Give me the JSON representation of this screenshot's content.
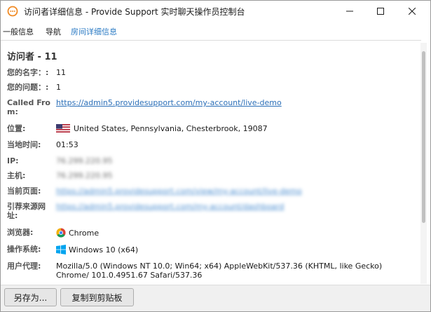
{
  "window": {
    "title": "访问者详细信息 - Provide Support 实时聊天操作员控制台"
  },
  "tabs": [
    {
      "label": "一般信息"
    },
    {
      "label": "导航"
    },
    {
      "label": "房间详细信息"
    }
  ],
  "visitor": {
    "heading": "访问者 - 11",
    "fields": {
      "name": {
        "label": "您的名字：:",
        "value": "11"
      },
      "question": {
        "label": "您的问题：:",
        "value": "1"
      },
      "called_from": {
        "label": "Called From:",
        "value": "https://admin5.providesupport.com/my-account/live-demo"
      },
      "location": {
        "label": "位置:",
        "value": "United States, Pennsylvania, Chesterbrook, 19087"
      },
      "local_time": {
        "label": "当地时间:",
        "value": "01:53"
      },
      "ip": {
        "label": "IP:",
        "value": "76.299.220.95"
      },
      "host": {
        "label": "主机:",
        "value": "76.299.220.95"
      },
      "current_page": {
        "label": "当前页面:",
        "value": "https://admin5.providesupport.com/view/my-account/live-demo"
      },
      "referrer": {
        "label": "引荐来源网址:",
        "value": "https://admin5.providesupport.com/my-account/dashboard"
      },
      "browser": {
        "label": "浏览器:",
        "value": "Chrome"
      },
      "os": {
        "label": "操作系统:",
        "value": "Windows 10 (x64)"
      },
      "user_agent": {
        "label": "用户代理:",
        "value": "Mozilla/5.0 (Windows NT 10.0; Win64; x64) AppleWebKit/537.36 (KHTML, like Gecko) Chrome/ 101.0.4951.67 Safari/537.36"
      }
    }
  },
  "footer": {
    "save_as": "另存为...",
    "copy_to_clipboard": "复制到剪贴板"
  },
  "icons": {
    "app": "chat-bubble-icon",
    "flag": "us-flag-icon",
    "browser": "chrome-icon",
    "os": "windows-icon"
  },
  "colors": {
    "accent": "#2b7bc4",
    "link": "#2b6fb8",
    "app_icon": "#f08a24"
  }
}
